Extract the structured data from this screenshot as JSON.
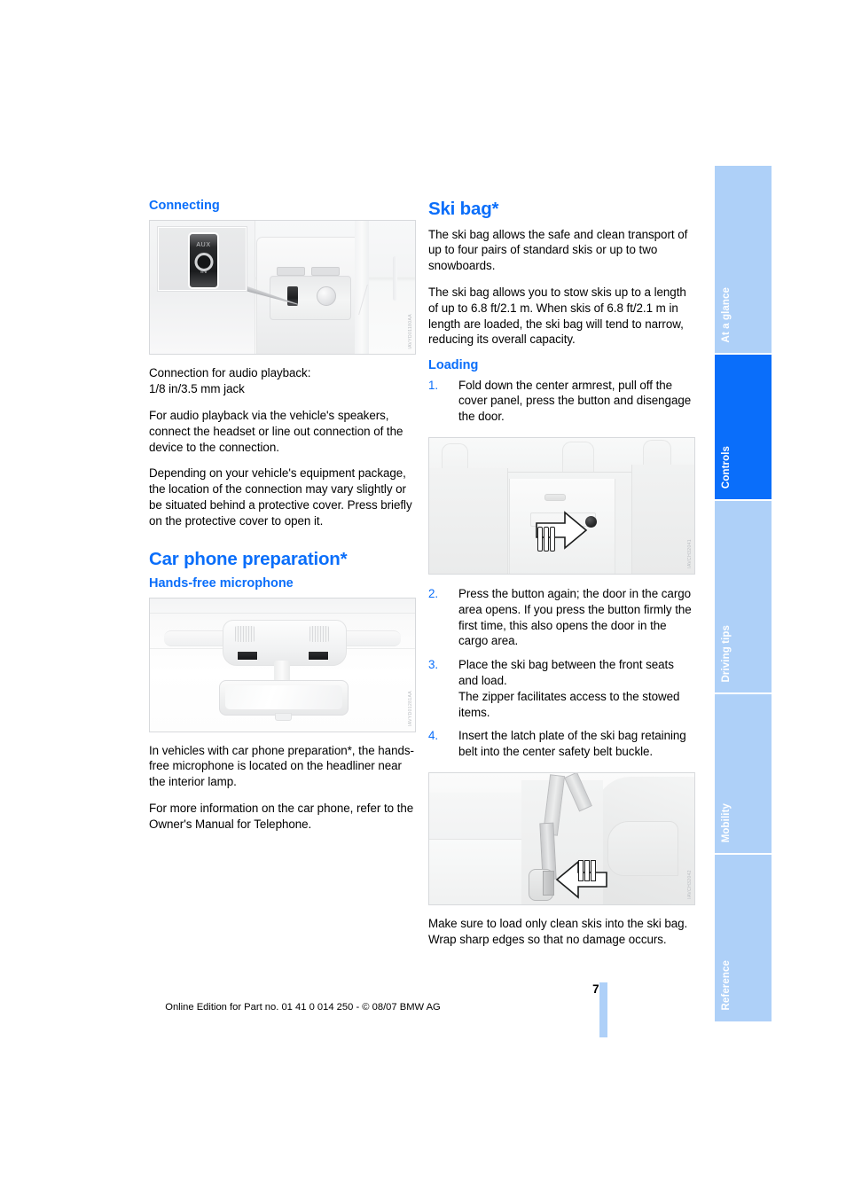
{
  "colors": {
    "accent_blue": "#0a6efa",
    "tab_inactive": "#aed0f8",
    "text": "#000000"
  },
  "left_column": {
    "heading_connecting": "Connecting",
    "figure_aux": {
      "name": "aux-in-connection-photo",
      "code": "IAVYD01180AA",
      "labels": {
        "aux": "AUX",
        "in": "IN"
      }
    },
    "caption_line1": "Connection for audio playback:",
    "caption_line2": "1/8 in/3.5 mm jack",
    "paragraph_1": "For audio playback via the vehicle's speakers, connect the headset or line out connection of the device to the connection.",
    "paragraph_2": "Depending on your vehicle's equipment package, the location of the connection may vary slightly or be situated behind a protective cover. Press briefly on the protective cover to open it.",
    "heading_car_phone": "Car phone preparation*",
    "heading_handsfree": "Hands-free microphone",
    "figure_mic": {
      "name": "hands-free-microphone-photo",
      "code": "IAVYD01281AA"
    },
    "paragraph_3": "In vehicles with car phone preparation*, the hands-free microphone is located on the headliner near the interior lamp.",
    "paragraph_4": "For more information on the car phone, refer to the Owner's Manual for Telephone."
  },
  "right_column": {
    "heading_ski_bag": "Ski bag*",
    "paragraph_1": "The ski bag allows the safe and clean transport of up to four pairs of standard skis or up to two snowboards.",
    "paragraph_2": "The ski bag allows you to stow skis up to a length of up to 6.8 ft/2.1 m. When skis of 6.8 ft/2.1 m in length are loaded, the ski bag will tend to narrow, reducing its overall capacity.",
    "heading_loading": "Loading",
    "steps": [
      {
        "num": "1.",
        "text": "Fold down the center armrest, pull off the cover panel, press the button and disengage the door."
      },
      {
        "num": "2.",
        "text": "Press the button again; the door in the cargo area opens. If you press the button firmly the first time, this also opens the door in the cargo area."
      },
      {
        "num": "3.",
        "text": "Place the ski bag between the front seats and load.\nThe zipper facilitates access to the stowed items."
      },
      {
        "num": "4.",
        "text": "Insert the latch plate of the ski bag retaining belt into the center safety belt buckle."
      }
    ],
    "figure_door": {
      "name": "armrest-door-button-photo",
      "code": "IAVCH32041"
    },
    "figure_belt": {
      "name": "ski-bag-belt-buckle-photo",
      "code": "IAVCH32042"
    },
    "closing_paragraph": "Make sure to load only clean skis into the ski bag. Wrap sharp edges so that no damage occurs."
  },
  "sidebar_tabs": [
    {
      "label": "At a glance",
      "active": false
    },
    {
      "label": "Controls",
      "active": true
    },
    {
      "label": "Driving tips",
      "active": false
    },
    {
      "label": "Mobility",
      "active": false
    },
    {
      "label": "Reference",
      "active": false
    }
  ],
  "footer": {
    "page_number": "75",
    "imprint": "Online Edition for Part no. 01 41 0 014 250 - © 08/07 BMW AG"
  }
}
